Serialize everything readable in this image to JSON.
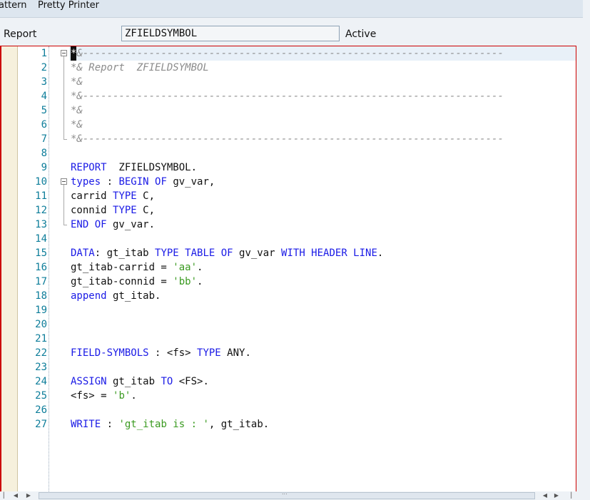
{
  "toolbar": {
    "pattern_label": "attern",
    "pretty_printer_label": "Pretty Printer"
  },
  "header": {
    "report_label": "Report",
    "program_name": "ZFIELDSYMBOL",
    "status": "Active"
  },
  "editor": {
    "lines": [
      {
        "n": "1",
        "tokens": [
          {
            "t": "*",
            "c": "cursor"
          },
          {
            "t": "&----------------------------------------------------------------------",
            "c": "c"
          }
        ]
      },
      {
        "n": "2",
        "tokens": [
          {
            "t": "*& Report  ZFIELDSYMBOL",
            "c": "c"
          }
        ]
      },
      {
        "n": "3",
        "tokens": [
          {
            "t": "*&",
            "c": "c"
          }
        ]
      },
      {
        "n": "4",
        "tokens": [
          {
            "t": "*&----------------------------------------------------------------------",
            "c": "c"
          }
        ]
      },
      {
        "n": "5",
        "tokens": [
          {
            "t": "*&",
            "c": "c"
          }
        ]
      },
      {
        "n": "6",
        "tokens": [
          {
            "t": "*&",
            "c": "c"
          }
        ]
      },
      {
        "n": "7",
        "tokens": [
          {
            "t": "*&----------------------------------------------------------------------",
            "c": "c"
          }
        ]
      },
      {
        "n": "8",
        "tokens": []
      },
      {
        "n": "9",
        "tokens": [
          {
            "t": "REPORT",
            "c": "k"
          },
          {
            "t": "  ZFIELDSYMBOL.",
            "c": ""
          }
        ]
      },
      {
        "n": "10",
        "tokens": [
          {
            "t": "types",
            "c": "k"
          },
          {
            "t": " : ",
            "c": ""
          },
          {
            "t": "BEGIN OF",
            "c": "k"
          },
          {
            "t": " gv_var,",
            "c": ""
          }
        ]
      },
      {
        "n": "11",
        "tokens": [
          {
            "t": "carrid ",
            "c": ""
          },
          {
            "t": "TYPE",
            "c": "k"
          },
          {
            "t": " C,",
            "c": ""
          }
        ]
      },
      {
        "n": "12",
        "tokens": [
          {
            "t": "connid ",
            "c": ""
          },
          {
            "t": "TYPE",
            "c": "k"
          },
          {
            "t": " C,",
            "c": ""
          }
        ]
      },
      {
        "n": "13",
        "tokens": [
          {
            "t": "END OF",
            "c": "k"
          },
          {
            "t": " gv_var.",
            "c": ""
          }
        ]
      },
      {
        "n": "14",
        "tokens": []
      },
      {
        "n": "15",
        "tokens": [
          {
            "t": "DATA",
            "c": "k"
          },
          {
            "t": ": gt_itab ",
            "c": ""
          },
          {
            "t": "TYPE TABLE OF",
            "c": "k"
          },
          {
            "t": " gv_var ",
            "c": ""
          },
          {
            "t": "WITH HEADER LINE",
            "c": "k"
          },
          {
            "t": ".",
            "c": ""
          }
        ]
      },
      {
        "n": "16",
        "tokens": [
          {
            "t": "gt_itab-carrid = ",
            "c": ""
          },
          {
            "t": "'aa'",
            "c": "s"
          },
          {
            "t": ".",
            "c": ""
          }
        ]
      },
      {
        "n": "17",
        "tokens": [
          {
            "t": "gt_itab-connid = ",
            "c": ""
          },
          {
            "t": "'bb'",
            "c": "s"
          },
          {
            "t": ".",
            "c": ""
          }
        ]
      },
      {
        "n": "18",
        "tokens": [
          {
            "t": "append",
            "c": "k"
          },
          {
            "t": " gt_itab.",
            "c": ""
          }
        ]
      },
      {
        "n": "19",
        "tokens": []
      },
      {
        "n": "20",
        "tokens": []
      },
      {
        "n": "21",
        "tokens": []
      },
      {
        "n": "22",
        "tokens": [
          {
            "t": "FIELD-SYMBOLS",
            "c": "k"
          },
          {
            "t": " : <fs> ",
            "c": ""
          },
          {
            "t": "TYPE",
            "c": "k"
          },
          {
            "t": " ANY.",
            "c": ""
          }
        ]
      },
      {
        "n": "23",
        "tokens": []
      },
      {
        "n": "24",
        "tokens": [
          {
            "t": "ASSIGN",
            "c": "k"
          },
          {
            "t": " gt_itab ",
            "c": ""
          },
          {
            "t": "TO",
            "c": "k"
          },
          {
            "t": " <FS>.",
            "c": ""
          }
        ]
      },
      {
        "n": "25",
        "tokens": [
          {
            "t": "<fs> = ",
            "c": ""
          },
          {
            "t": "'b'",
            "c": "s"
          },
          {
            "t": ".",
            "c": ""
          }
        ]
      },
      {
        "n": "26",
        "tokens": []
      },
      {
        "n": "27",
        "tokens": [
          {
            "t": "WRITE",
            "c": "k"
          },
          {
            "t": " : ",
            "c": ""
          },
          {
            "t": "'gt_itab is : '",
            "c": "s"
          },
          {
            "t": ", gt_itab.",
            "c": ""
          }
        ]
      }
    ]
  },
  "scrollbar": {
    "grip": "..."
  }
}
